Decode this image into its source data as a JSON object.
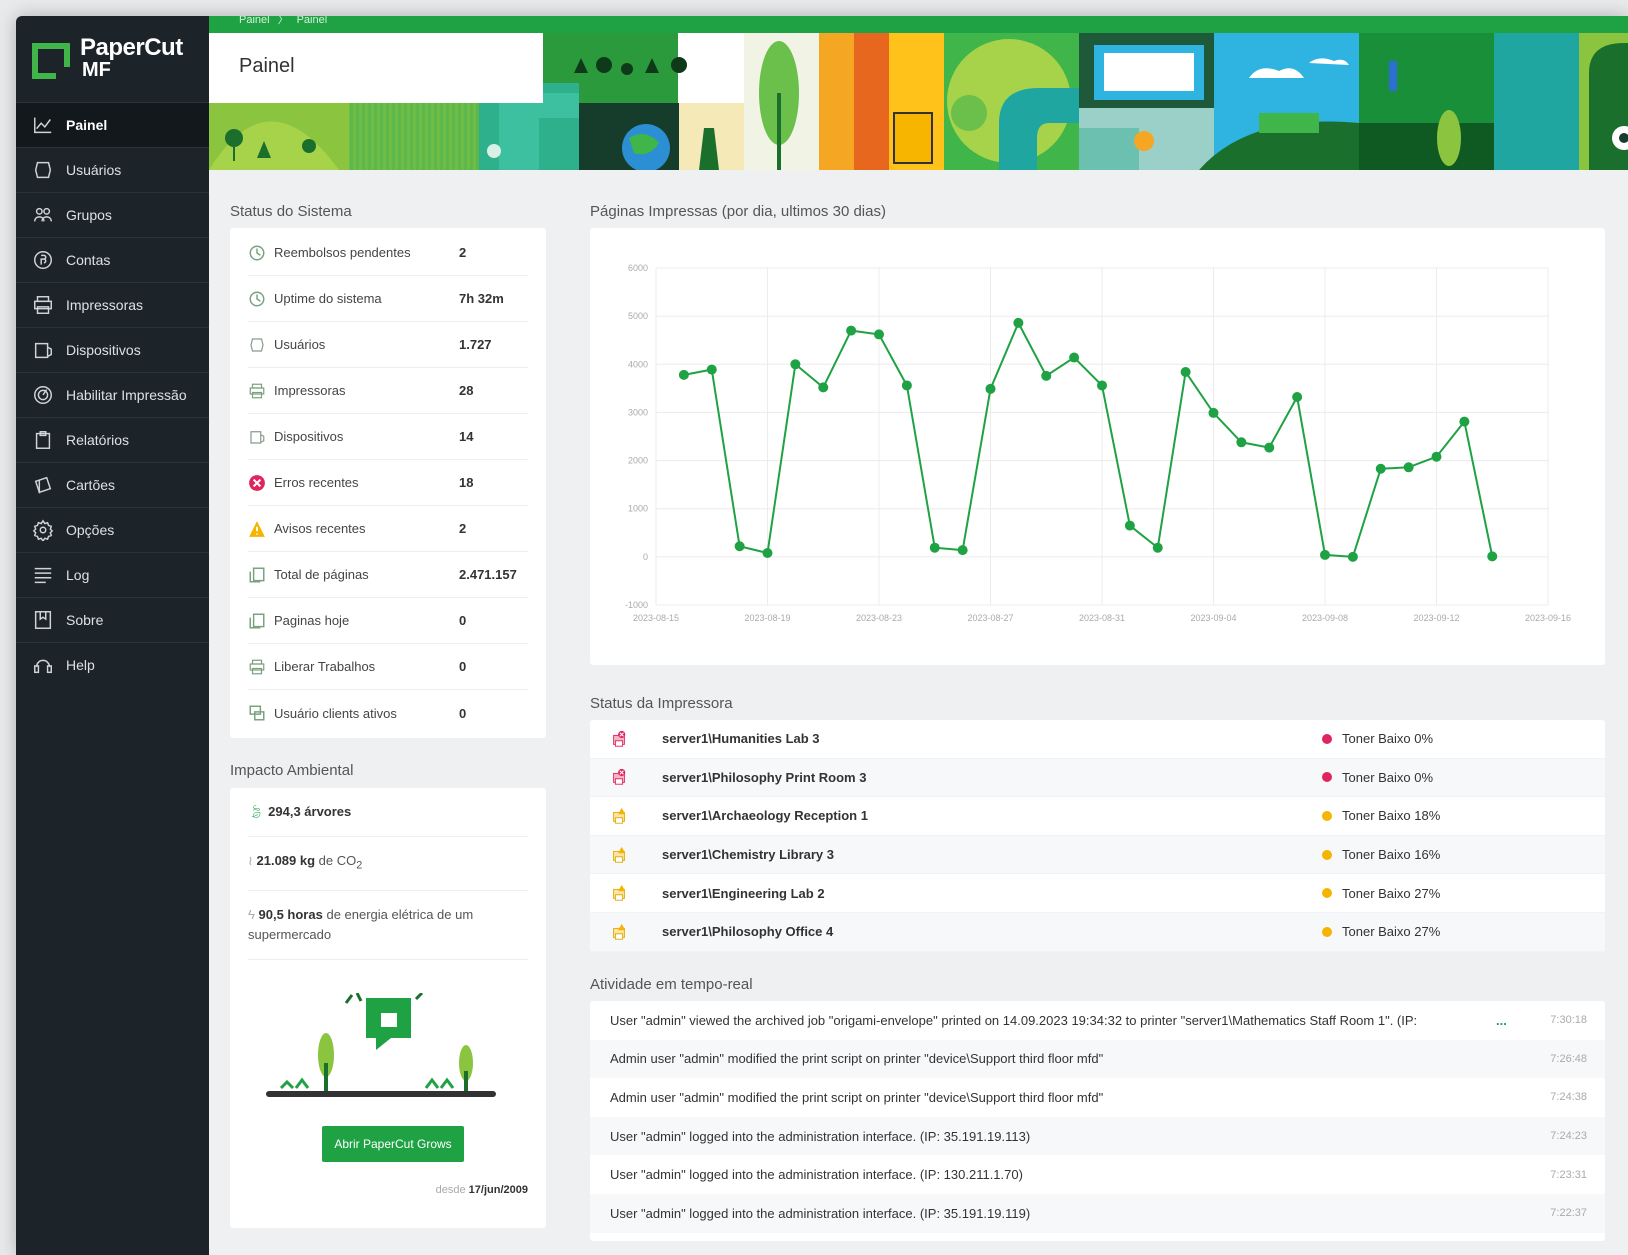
{
  "app": {
    "logo_line1": "PaperCut",
    "logo_line2": "MF"
  },
  "breadcrumb": [
    "Painel",
    "Painel"
  ],
  "page_title": "Painel",
  "sidebar": {
    "items": [
      {
        "label": "Painel",
        "icon": "chart-line-icon",
        "active": true
      },
      {
        "label": "Usuários",
        "icon": "user-icon"
      },
      {
        "label": "Grupos",
        "icon": "group-icon"
      },
      {
        "label": "Contas",
        "icon": "account-coin-icon"
      },
      {
        "label": "Impressoras",
        "icon": "printer-icon"
      },
      {
        "label": "Dispositivos",
        "icon": "device-icon"
      },
      {
        "label": "Habilitar Impressão",
        "icon": "release-icon"
      },
      {
        "label": "Relatórios",
        "icon": "clipboard-icon"
      },
      {
        "label": "Cartões",
        "icon": "card-icon"
      },
      {
        "label": "Opções",
        "icon": "gear-icon"
      },
      {
        "label": "Log",
        "icon": "list-icon"
      },
      {
        "label": "Sobre",
        "icon": "book-icon"
      },
      {
        "label": "Help",
        "icon": "help-icon"
      }
    ]
  },
  "system_status": {
    "title": "Status do Sistema",
    "rows": [
      {
        "label": "Reembolsos pendentes",
        "value": "2",
        "icon": "clock-icon",
        "color": "#7aa07e"
      },
      {
        "label": "Uptime do sistema",
        "value": "7h 32m",
        "icon": "clock-icon",
        "color": "#7aa07e"
      },
      {
        "label": "Usuários",
        "value": "1.727",
        "icon": "user-icon",
        "color": "#8a9a8c"
      },
      {
        "label": "Impressoras",
        "value": "28",
        "icon": "printer-icon",
        "color": "#7aa07e"
      },
      {
        "label": "Dispositivos",
        "value": "14",
        "icon": "device-icon",
        "color": "#8a9a8c"
      },
      {
        "label": "Erros recentes",
        "value": "18",
        "icon": "error-icon",
        "color": "#e0245e"
      },
      {
        "label": "Avisos recentes",
        "value": "2",
        "icon": "warning-icon",
        "color": "#f5b400"
      },
      {
        "label": "Total de páginas",
        "value": "2.471.157",
        "icon": "pages-icon",
        "color": "#7aa07e"
      },
      {
        "label": "Paginas hoje",
        "value": "0",
        "icon": "pages-icon",
        "color": "#7aa07e"
      },
      {
        "label": "Liberar Trabalhos",
        "value": "0",
        "icon": "printer-icon",
        "color": "#7aa07e"
      },
      {
        "label": "Usuário clients ativos",
        "value": "0",
        "icon": "client-icon",
        "color": "#7aa07e"
      }
    ]
  },
  "environment": {
    "title": "Impacto Ambiental",
    "trees_value": "294,3 árvores",
    "co2_value": "21.089 kg",
    "co2_text": "de CO",
    "co2_sub": "2",
    "energy_value": "90,5 horas",
    "energy_text": "de energia elétrica de um supermercado",
    "button_label": "Abrir PaperCut Grows",
    "since_label": "desde",
    "since_date": "17/jun/2009"
  },
  "chart_title": "Páginas Impressas (por dia, ultimos 30 dias)",
  "chart_data": {
    "type": "line",
    "title": "Páginas Impressas (por dia, ultimos 30 dias)",
    "ylim": [
      -1000,
      6000
    ],
    "yticks": [
      "-1000",
      "0",
      "1000",
      "2000",
      "3000",
      "4000",
      "5000",
      "6000"
    ],
    "xticks": [
      "2023-08-15",
      "2023-08-19",
      "2023-08-23",
      "2023-08-27",
      "2023-08-31",
      "2023-09-04",
      "2023-09-08",
      "2023-09-12",
      "2023-09-16"
    ],
    "x_start": "2023-08-15",
    "x_end": "2023-09-16",
    "color": "#1fa244",
    "points": [
      {
        "x": "2023-08-16",
        "y": 3780
      },
      {
        "x": "2023-08-17",
        "y": 3890
      },
      {
        "x": "2023-08-18",
        "y": 220
      },
      {
        "x": "2023-08-19",
        "y": 80
      },
      {
        "x": "2023-08-20",
        "y": 4000
      },
      {
        "x": "2023-08-21",
        "y": 3520
      },
      {
        "x": "2023-08-22",
        "y": 4700
      },
      {
        "x": "2023-08-23",
        "y": 4620
      },
      {
        "x": "2023-08-24",
        "y": 3560
      },
      {
        "x": "2023-08-25",
        "y": 190
      },
      {
        "x": "2023-08-26",
        "y": 140
      },
      {
        "x": "2023-08-27",
        "y": 3490
      },
      {
        "x": "2023-08-28",
        "y": 4860
      },
      {
        "x": "2023-08-29",
        "y": 3760
      },
      {
        "x": "2023-08-30",
        "y": 4140
      },
      {
        "x": "2023-08-31",
        "y": 3560
      },
      {
        "x": "2023-09-01",
        "y": 650
      },
      {
        "x": "2023-09-02",
        "y": 190
      },
      {
        "x": "2023-09-03",
        "y": 3840
      },
      {
        "x": "2023-09-04",
        "y": 2990
      },
      {
        "x": "2023-09-05",
        "y": 2380
      },
      {
        "x": "2023-09-06",
        "y": 2270
      },
      {
        "x": "2023-09-07",
        "y": 3320
      },
      {
        "x": "2023-09-08",
        "y": 40
      },
      {
        "x": "2023-09-09",
        "y": 0
      },
      {
        "x": "2023-09-10",
        "y": 1830
      },
      {
        "x": "2023-09-11",
        "y": 1860
      },
      {
        "x": "2023-09-12",
        "y": 2080
      },
      {
        "x": "2023-09-13",
        "y": 2810
      },
      {
        "x": "2023-09-14",
        "y": 10
      }
    ]
  },
  "printer_status": {
    "title": "Status da Impressora",
    "rows": [
      {
        "name": "server1\\Humanities Lab 3",
        "status": "Toner Baixo 0%",
        "dot_color": "#e0245e",
        "icon": "printer-error-icon"
      },
      {
        "name": "server1\\Philosophy Print Room 3",
        "status": "Toner Baixo 0%",
        "dot_color": "#e0245e",
        "icon": "printer-error-icon"
      },
      {
        "name": "server1\\Archaeology Reception 1",
        "status": "Toner Baixo 18%",
        "dot_color": "#f5b400",
        "icon": "printer-warning-icon"
      },
      {
        "name": "server1\\Chemistry Library 3",
        "status": "Toner Baixo 16%",
        "dot_color": "#f5b400",
        "icon": "printer-warning-icon"
      },
      {
        "name": "server1\\Engineering Lab 2",
        "status": "Toner Baixo 27%",
        "dot_color": "#f5b400",
        "icon": "printer-warning-icon"
      },
      {
        "name": "server1\\Philosophy Office 4",
        "status": "Toner Baixo 27%",
        "dot_color": "#f5b400",
        "icon": "printer-warning-icon"
      }
    ]
  },
  "activity": {
    "title": "Atividade em tempo-real",
    "more_label": "...",
    "rows": [
      {
        "message": "User \"admin\" viewed the archived job \"origami-envelope\" printed on 14.09.2023 19:34:32 to printer \"server1\\Mathematics Staff Room 1\". (IP:",
        "time": "7:30:18",
        "truncated": true
      },
      {
        "message": "Admin user \"admin\" modified the print script on printer \"device\\Support third floor mfd\"",
        "time": "7:26:48"
      },
      {
        "message": "Admin user \"admin\" modified the print script on printer \"device\\Support third floor mfd\"",
        "time": "7:24:38"
      },
      {
        "message": "User \"admin\" logged into the administration interface. (IP: 35.191.19.113)",
        "time": "7:24:23"
      },
      {
        "message": "User \"admin\" logged into the administration interface. (IP: 130.211.1.70)",
        "time": "7:23:31"
      },
      {
        "message": "User \"admin\" logged into the administration interface. (IP: 35.191.19.119)",
        "time": "7:22:37"
      }
    ]
  }
}
